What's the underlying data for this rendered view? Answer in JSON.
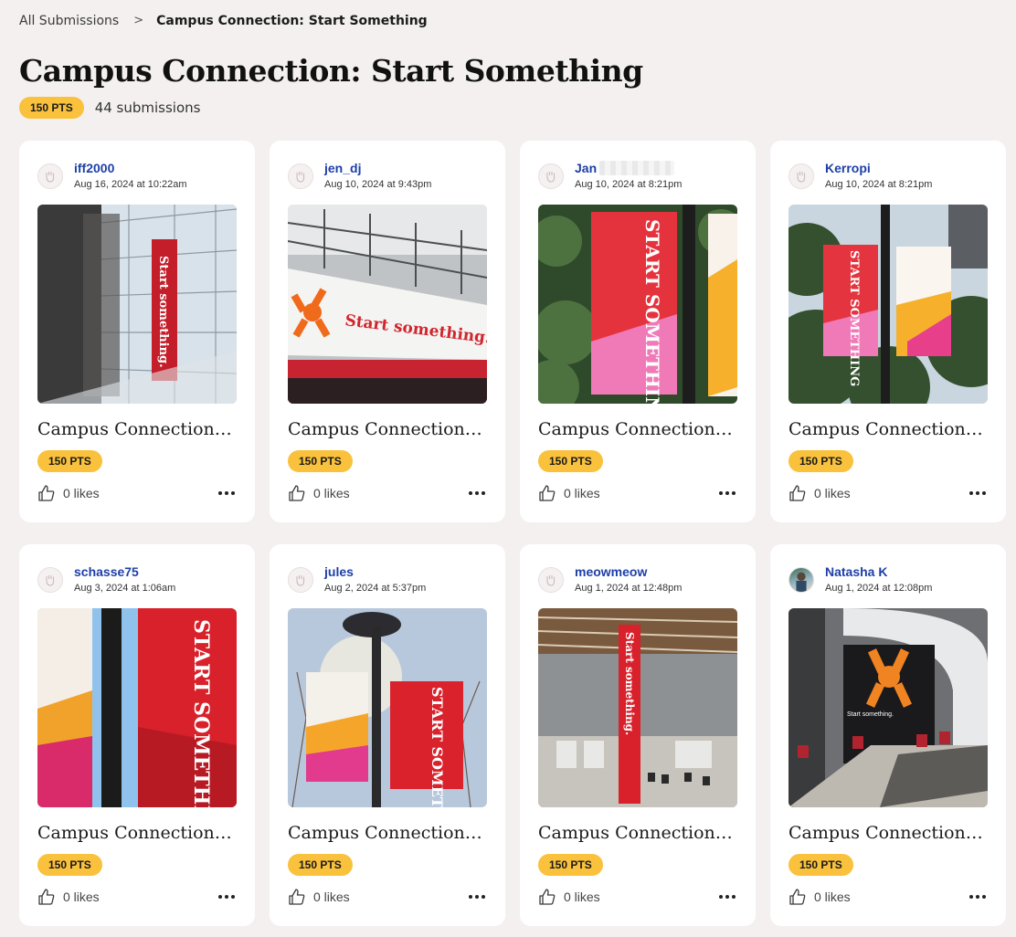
{
  "breadcrumb": {
    "root": "All Submissions",
    "separator": ">",
    "current": "Campus Connection: Start Something"
  },
  "page": {
    "title": "Campus Connection: Start Something",
    "points": "150 PTS",
    "submissions": "44 submissions"
  },
  "colors": {
    "badge": "#f9c13c",
    "username": "#1d3fa8",
    "background": "#f4f0f0"
  },
  "cards": [
    {
      "user": "iff2000",
      "date": "Aug 16, 2024 at 10:22am",
      "title": "Campus Connection: Start Something",
      "points": "150 PTS",
      "likes": "0 likes",
      "photo_text": "Start something.",
      "avatar": "fist-icon"
    },
    {
      "user": "jen_dj",
      "date": "Aug 10, 2024 at 9:43pm",
      "title": "Campus Connection: Start Something",
      "points": "150 PTS",
      "likes": "0 likes",
      "photo_text": "Start something.",
      "avatar": "fist-icon"
    },
    {
      "user": "Jan",
      "date": "Aug 10, 2024 at 8:21pm",
      "title": "Campus Connection: Start Something",
      "points": "150 PTS",
      "likes": "0 likes",
      "photo_text": "START SOMETHING",
      "avatar": "fist-icon",
      "name_redacted": true
    },
    {
      "user": "Kerropi",
      "date": "Aug 10, 2024 at 8:21pm",
      "title": "Campus Connection: Start Something",
      "points": "150 PTS",
      "likes": "0 likes",
      "photo_text": "START SOMETHING",
      "avatar": "fist-icon"
    },
    {
      "user": "schasse75",
      "date": "Aug 3, 2024 at 1:06am",
      "title": "Campus Connection: Start Something",
      "points": "150 PTS",
      "likes": "0 likes",
      "photo_text": "START SOMETHING",
      "avatar": "fist-icon"
    },
    {
      "user": "jules",
      "date": "Aug 2, 2024 at 5:37pm",
      "title": "Campus Connection: Start Something",
      "points": "150 PTS",
      "likes": "0 likes",
      "photo_text": "START SOMETHING",
      "avatar": "fist-icon"
    },
    {
      "user": "meowmeow",
      "date": "Aug 1, 2024 at 12:48pm",
      "title": "Campus Connection: Start Something",
      "points": "150 PTS",
      "likes": "0 likes",
      "photo_text": "Start something.",
      "avatar": "fist-icon"
    },
    {
      "user": "Natasha K",
      "date": "Aug 1, 2024 at 12:08pm",
      "title": "Campus Connection: Start Something",
      "points": "150 PTS",
      "likes": "0 likes",
      "photo_text": "Start something.",
      "avatar": "photo-avatar"
    }
  ]
}
